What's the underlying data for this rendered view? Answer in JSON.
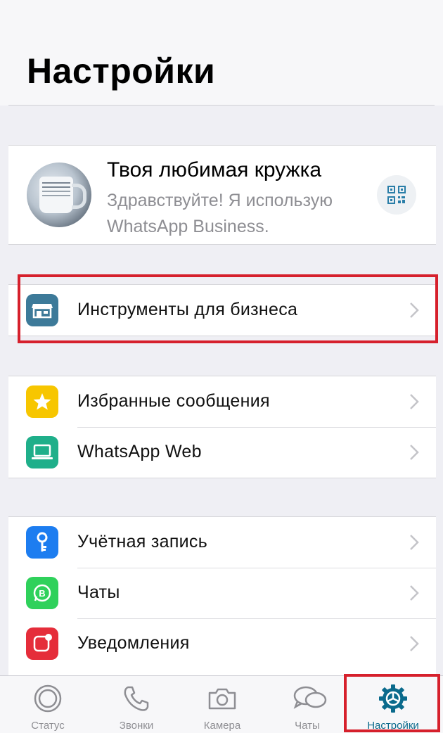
{
  "header": {
    "title": "Настройки"
  },
  "profile": {
    "name": "Твоя любимая кружка",
    "status": "Здравствуйте! Я использую WhatsApp Business."
  },
  "sections": {
    "business": {
      "label": "Инструменты для бизнеса",
      "color": "#3d7a99"
    },
    "starred": {
      "label": "Избранные сообщения",
      "color": "#f7c600"
    },
    "web": {
      "label": "WhatsApp Web",
      "color": "#1faf8a"
    },
    "account": {
      "label": "Учётная запись",
      "color": "#1d7df0"
    },
    "chats": {
      "label": "Чаты",
      "color": "#2fd15b"
    },
    "notifications": {
      "label": "Уведомления",
      "color": "#e52d3a"
    }
  },
  "tabs": [
    {
      "label": "Статус",
      "icon": "status-icon"
    },
    {
      "label": "Звонки",
      "icon": "phone-icon"
    },
    {
      "label": "Камера",
      "icon": "camera-icon"
    },
    {
      "label": "Чаты",
      "icon": "chats-icon"
    },
    {
      "label": "Настройки",
      "icon": "settings-gear-icon",
      "active": true
    }
  ],
  "colors": {
    "accent": "#0a6a8c",
    "highlight": "#d6202c",
    "inactive": "#8e8e93"
  }
}
